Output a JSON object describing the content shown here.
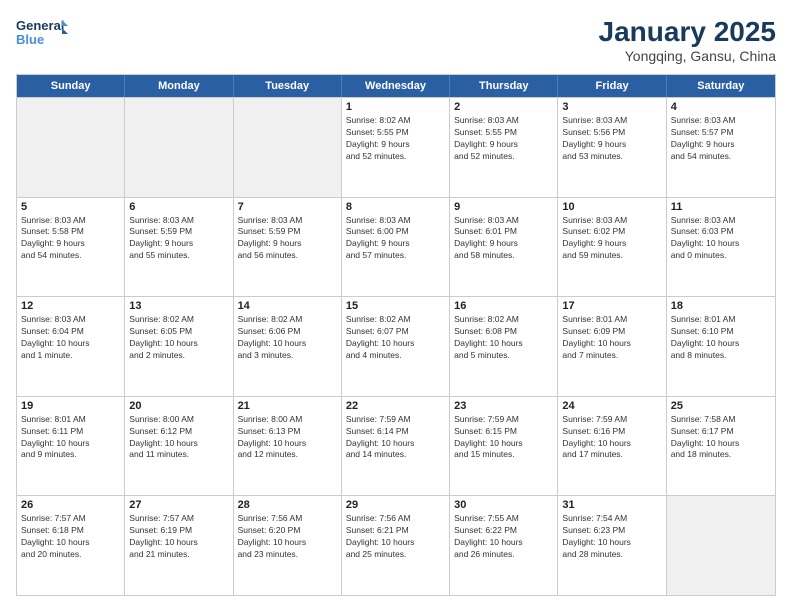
{
  "logo": {
    "line1": "General",
    "line2": "Blue"
  },
  "title": "January 2025",
  "subtitle": "Yongqing, Gansu, China",
  "days": [
    "Sunday",
    "Monday",
    "Tuesday",
    "Wednesday",
    "Thursday",
    "Friday",
    "Saturday"
  ],
  "weeks": [
    [
      {
        "day": "",
        "info": [],
        "shaded": true
      },
      {
        "day": "",
        "info": [],
        "shaded": true
      },
      {
        "day": "",
        "info": [],
        "shaded": true
      },
      {
        "day": "1",
        "info": [
          "Sunrise: 8:02 AM",
          "Sunset: 5:55 PM",
          "Daylight: 9 hours",
          "and 52 minutes."
        ]
      },
      {
        "day": "2",
        "info": [
          "Sunrise: 8:03 AM",
          "Sunset: 5:55 PM",
          "Daylight: 9 hours",
          "and 52 minutes."
        ]
      },
      {
        "day": "3",
        "info": [
          "Sunrise: 8:03 AM",
          "Sunset: 5:56 PM",
          "Daylight: 9 hours",
          "and 53 minutes."
        ]
      },
      {
        "day": "4",
        "info": [
          "Sunrise: 8:03 AM",
          "Sunset: 5:57 PM",
          "Daylight: 9 hours",
          "and 54 minutes."
        ]
      }
    ],
    [
      {
        "day": "5",
        "info": [
          "Sunrise: 8:03 AM",
          "Sunset: 5:58 PM",
          "Daylight: 9 hours",
          "and 54 minutes."
        ]
      },
      {
        "day": "6",
        "info": [
          "Sunrise: 8:03 AM",
          "Sunset: 5:59 PM",
          "Daylight: 9 hours",
          "and 55 minutes."
        ]
      },
      {
        "day": "7",
        "info": [
          "Sunrise: 8:03 AM",
          "Sunset: 5:59 PM",
          "Daylight: 9 hours",
          "and 56 minutes."
        ]
      },
      {
        "day": "8",
        "info": [
          "Sunrise: 8:03 AM",
          "Sunset: 6:00 PM",
          "Daylight: 9 hours",
          "and 57 minutes."
        ]
      },
      {
        "day": "9",
        "info": [
          "Sunrise: 8:03 AM",
          "Sunset: 6:01 PM",
          "Daylight: 9 hours",
          "and 58 minutes."
        ]
      },
      {
        "day": "10",
        "info": [
          "Sunrise: 8:03 AM",
          "Sunset: 6:02 PM",
          "Daylight: 9 hours",
          "and 59 minutes."
        ]
      },
      {
        "day": "11",
        "info": [
          "Sunrise: 8:03 AM",
          "Sunset: 6:03 PM",
          "Daylight: 10 hours",
          "and 0 minutes."
        ]
      }
    ],
    [
      {
        "day": "12",
        "info": [
          "Sunrise: 8:03 AM",
          "Sunset: 6:04 PM",
          "Daylight: 10 hours",
          "and 1 minute."
        ]
      },
      {
        "day": "13",
        "info": [
          "Sunrise: 8:02 AM",
          "Sunset: 6:05 PM",
          "Daylight: 10 hours",
          "and 2 minutes."
        ]
      },
      {
        "day": "14",
        "info": [
          "Sunrise: 8:02 AM",
          "Sunset: 6:06 PM",
          "Daylight: 10 hours",
          "and 3 minutes."
        ]
      },
      {
        "day": "15",
        "info": [
          "Sunrise: 8:02 AM",
          "Sunset: 6:07 PM",
          "Daylight: 10 hours",
          "and 4 minutes."
        ]
      },
      {
        "day": "16",
        "info": [
          "Sunrise: 8:02 AM",
          "Sunset: 6:08 PM",
          "Daylight: 10 hours",
          "and 5 minutes."
        ]
      },
      {
        "day": "17",
        "info": [
          "Sunrise: 8:01 AM",
          "Sunset: 6:09 PM",
          "Daylight: 10 hours",
          "and 7 minutes."
        ]
      },
      {
        "day": "18",
        "info": [
          "Sunrise: 8:01 AM",
          "Sunset: 6:10 PM",
          "Daylight: 10 hours",
          "and 8 minutes."
        ]
      }
    ],
    [
      {
        "day": "19",
        "info": [
          "Sunrise: 8:01 AM",
          "Sunset: 6:11 PM",
          "Daylight: 10 hours",
          "and 9 minutes."
        ]
      },
      {
        "day": "20",
        "info": [
          "Sunrise: 8:00 AM",
          "Sunset: 6:12 PM",
          "Daylight: 10 hours",
          "and 11 minutes."
        ]
      },
      {
        "day": "21",
        "info": [
          "Sunrise: 8:00 AM",
          "Sunset: 6:13 PM",
          "Daylight: 10 hours",
          "and 12 minutes."
        ]
      },
      {
        "day": "22",
        "info": [
          "Sunrise: 7:59 AM",
          "Sunset: 6:14 PM",
          "Daylight: 10 hours",
          "and 14 minutes."
        ]
      },
      {
        "day": "23",
        "info": [
          "Sunrise: 7:59 AM",
          "Sunset: 6:15 PM",
          "Daylight: 10 hours",
          "and 15 minutes."
        ]
      },
      {
        "day": "24",
        "info": [
          "Sunrise: 7:59 AM",
          "Sunset: 6:16 PM",
          "Daylight: 10 hours",
          "and 17 minutes."
        ]
      },
      {
        "day": "25",
        "info": [
          "Sunrise: 7:58 AM",
          "Sunset: 6:17 PM",
          "Daylight: 10 hours",
          "and 18 minutes."
        ]
      }
    ],
    [
      {
        "day": "26",
        "info": [
          "Sunrise: 7:57 AM",
          "Sunset: 6:18 PM",
          "Daylight: 10 hours",
          "and 20 minutes."
        ]
      },
      {
        "day": "27",
        "info": [
          "Sunrise: 7:57 AM",
          "Sunset: 6:19 PM",
          "Daylight: 10 hours",
          "and 21 minutes."
        ]
      },
      {
        "day": "28",
        "info": [
          "Sunrise: 7:56 AM",
          "Sunset: 6:20 PM",
          "Daylight: 10 hours",
          "and 23 minutes."
        ]
      },
      {
        "day": "29",
        "info": [
          "Sunrise: 7:56 AM",
          "Sunset: 6:21 PM",
          "Daylight: 10 hours",
          "and 25 minutes."
        ]
      },
      {
        "day": "30",
        "info": [
          "Sunrise: 7:55 AM",
          "Sunset: 6:22 PM",
          "Daylight: 10 hours",
          "and 26 minutes."
        ]
      },
      {
        "day": "31",
        "info": [
          "Sunrise: 7:54 AM",
          "Sunset: 6:23 PM",
          "Daylight: 10 hours",
          "and 28 minutes."
        ]
      },
      {
        "day": "",
        "info": [],
        "shaded": true
      }
    ]
  ]
}
